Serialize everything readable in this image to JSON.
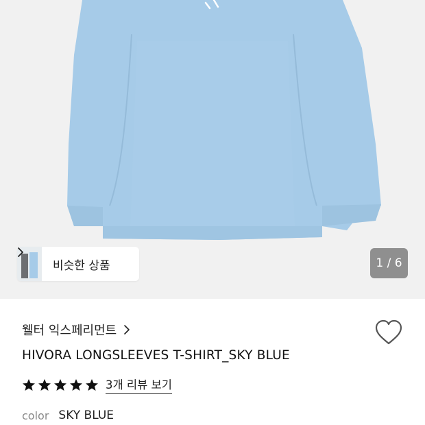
{
  "gallery": {
    "similar_label": "비슷한 상품",
    "page_indicator": "1 / 6"
  },
  "product": {
    "brand": "웰터 익스페리먼트",
    "title": "HIVORA LONGSLEEVES T-SHIRT_SKY BLUE",
    "rating_stars": 5,
    "review_link": "3개 리뷰 보기",
    "color_key": "color",
    "color_value": "SKY BLUE"
  },
  "icons": {
    "chevron": "chevron-right-icon",
    "heart": "heart-outline-icon",
    "star": "star-filled-icon"
  },
  "colors": {
    "garment": "#a6cbe8",
    "background": "#f1f1f1",
    "indicator": "#8f8f8f"
  }
}
